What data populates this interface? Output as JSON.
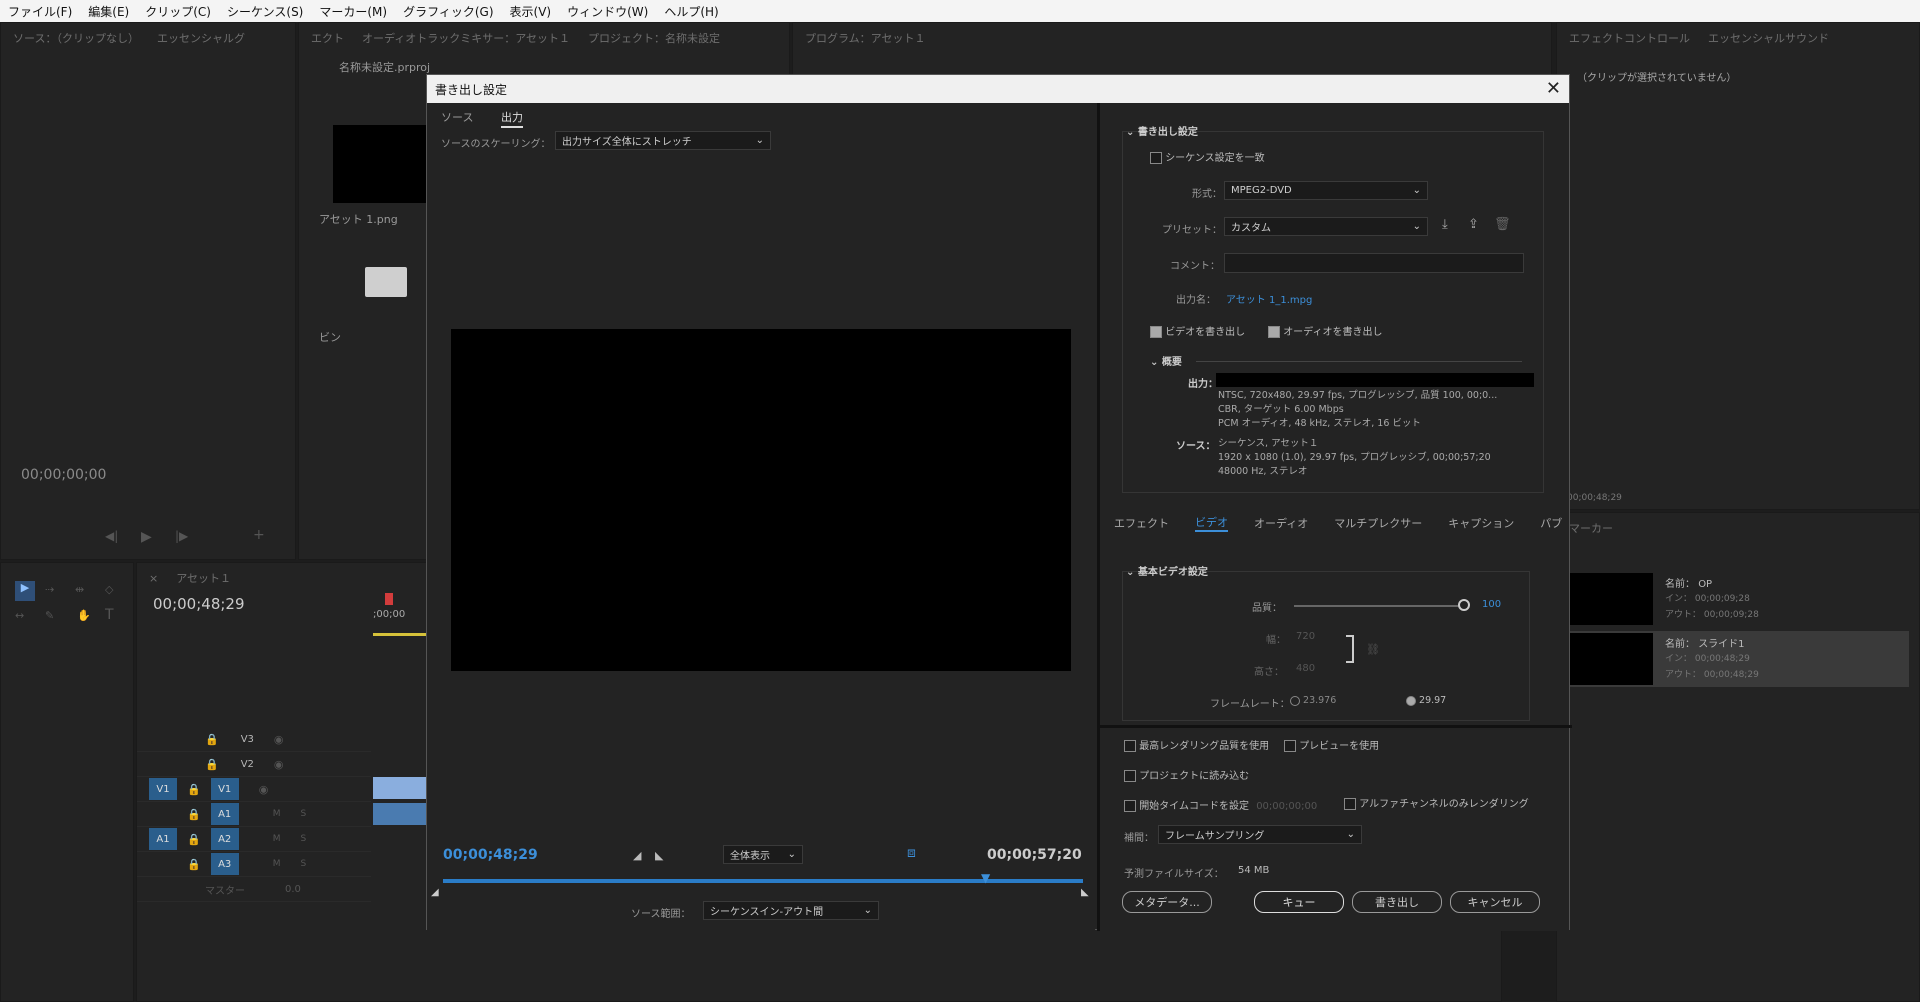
{
  "menu": [
    "ファイル(F)",
    "編集(E)",
    "クリップ(C)",
    "シーケンス(S)",
    "マーカー(M)",
    "グラフィック(G)",
    "表示(V)",
    "ウィンドウ(W)",
    "ヘルプ(H)"
  ],
  "source_panel": {
    "tabs": [
      "ソース：（クリップなし）",
      "エッセンシャルグ"
    ],
    "timecode": "00;00;00;00"
  },
  "project_panel": {
    "tabs": [
      "エクト",
      "オーディオトラックミキサー：アセット１",
      "プロジェクト：名称未設定"
    ],
    "filename": "名称未設定.prproj",
    "items": [
      {
        "name": "アセット 1.png"
      },
      {
        "name": "ビン"
      }
    ]
  },
  "program_panel": {
    "tab": "プログラム：アセット１"
  },
  "effects_panel": {
    "tabs": [
      "エフェクトコントロール",
      "エッセンシャルサウンド"
    ],
    "empty_text": "（クリップが選択されていません）",
    "timecode": "00;00;48;29"
  },
  "markers_panel": {
    "tab": "マーカー",
    "items": [
      {
        "name_label": "名前：",
        "name": "OP",
        "in_label": "イン：",
        "in": "00;00;09;28",
        "out_label": "アウト：",
        "out": "00;00;09;28"
      },
      {
        "name_label": "名前：",
        "name": "スライド1",
        "in_label": "イン：",
        "in": "00;00;48;29",
        "out_label": "アウト：",
        "out": "00;00;48;29"
      }
    ]
  },
  "timeline": {
    "tab": "アセット１",
    "timecode": "00;00;48;29",
    "ruler_label": ";00;00",
    "video_tracks": [
      "V3",
      "V2",
      "V1"
    ],
    "audio_tracks": [
      "A1",
      "A2",
      "A3"
    ],
    "master_label": "マスター",
    "master_value": "0.0",
    "src_v": "V1",
    "src_a": "A1",
    "m": "M",
    "s": "S"
  },
  "export_dialog": {
    "title": "書き出し設定",
    "close": "✕",
    "left": {
      "tabs": [
        "ソース",
        "出力"
      ],
      "scaling_label": "ソースのスケーリング：",
      "scaling_value": "出力サイズ全体にストレッチ",
      "tc_in": "00;00;48;29",
      "tc_out": "00;00;57;20",
      "zoom": "全体表示",
      "range_label": "ソース範囲：",
      "range_value": "シーケンスイン-アウト間"
    },
    "settings": {
      "header": "書き出し設定",
      "match_seq": "シーケンス設定を一致",
      "format_label": "形式：",
      "format_value": "MPEG2-DVD",
      "preset_label": "プリセット：",
      "preset_value": "カスタム",
      "comment_label": "コメント：",
      "comment_value": "",
      "outname_label": "出力名：",
      "outname_value": "アセット 1_1.mpg",
      "export_video": "ビデオを書き出し",
      "export_audio": "オーディオを書き出し",
      "summary_header": "概要",
      "output_label": "出力：",
      "output_lines": [
        "NTSC, 720x480, 29.97 fps, プログレッシブ, 品質 100, 00;0...",
        "CBR, ターゲット 6.00 Mbps",
        "PCM オーディオ, 48 kHz, ステレオ, 16 ビット"
      ],
      "source_label": "ソース：",
      "source_lines": [
        "シーケンス, アセット１",
        "1920 x 1080 (1.0), 29.97 fps, プログレッシブ, 00;00;57;20",
        "48000 Hz, ステレオ"
      ]
    },
    "tabs2": [
      "エフェクト",
      "ビデオ",
      "オーディオ",
      "マルチプレクサー",
      "キャプション",
      "パブ"
    ],
    "basic_video": {
      "header": "基本ビデオ設定",
      "quality_label": "品質：",
      "quality": 100,
      "width_label": "幅：",
      "width": "720",
      "height_label": "高さ：",
      "height": "480",
      "framerate_label": "フレームレート：",
      "fr1": "23.976",
      "fr2": "29.97"
    },
    "bottom": {
      "max_render": "最高レンダリング品質を使用",
      "use_preview": "プレビューを使用",
      "import_project": "プロジェクトに読み込む",
      "start_tc": "開始タイムコードを設定",
      "start_tc_value": "00;00;00;00",
      "alpha_only": "アルファチャンネルのみレンダリング",
      "interp_label": "補間：",
      "interp_value": "フレームサンプリング",
      "filesize_label": "予測ファイルサイズ：",
      "filesize_value": "54 MB",
      "btn_metadata": "メタデータ...",
      "btn_queue": "キュー",
      "btn_export": "書き出し",
      "btn_cancel": "キャンセル"
    }
  }
}
